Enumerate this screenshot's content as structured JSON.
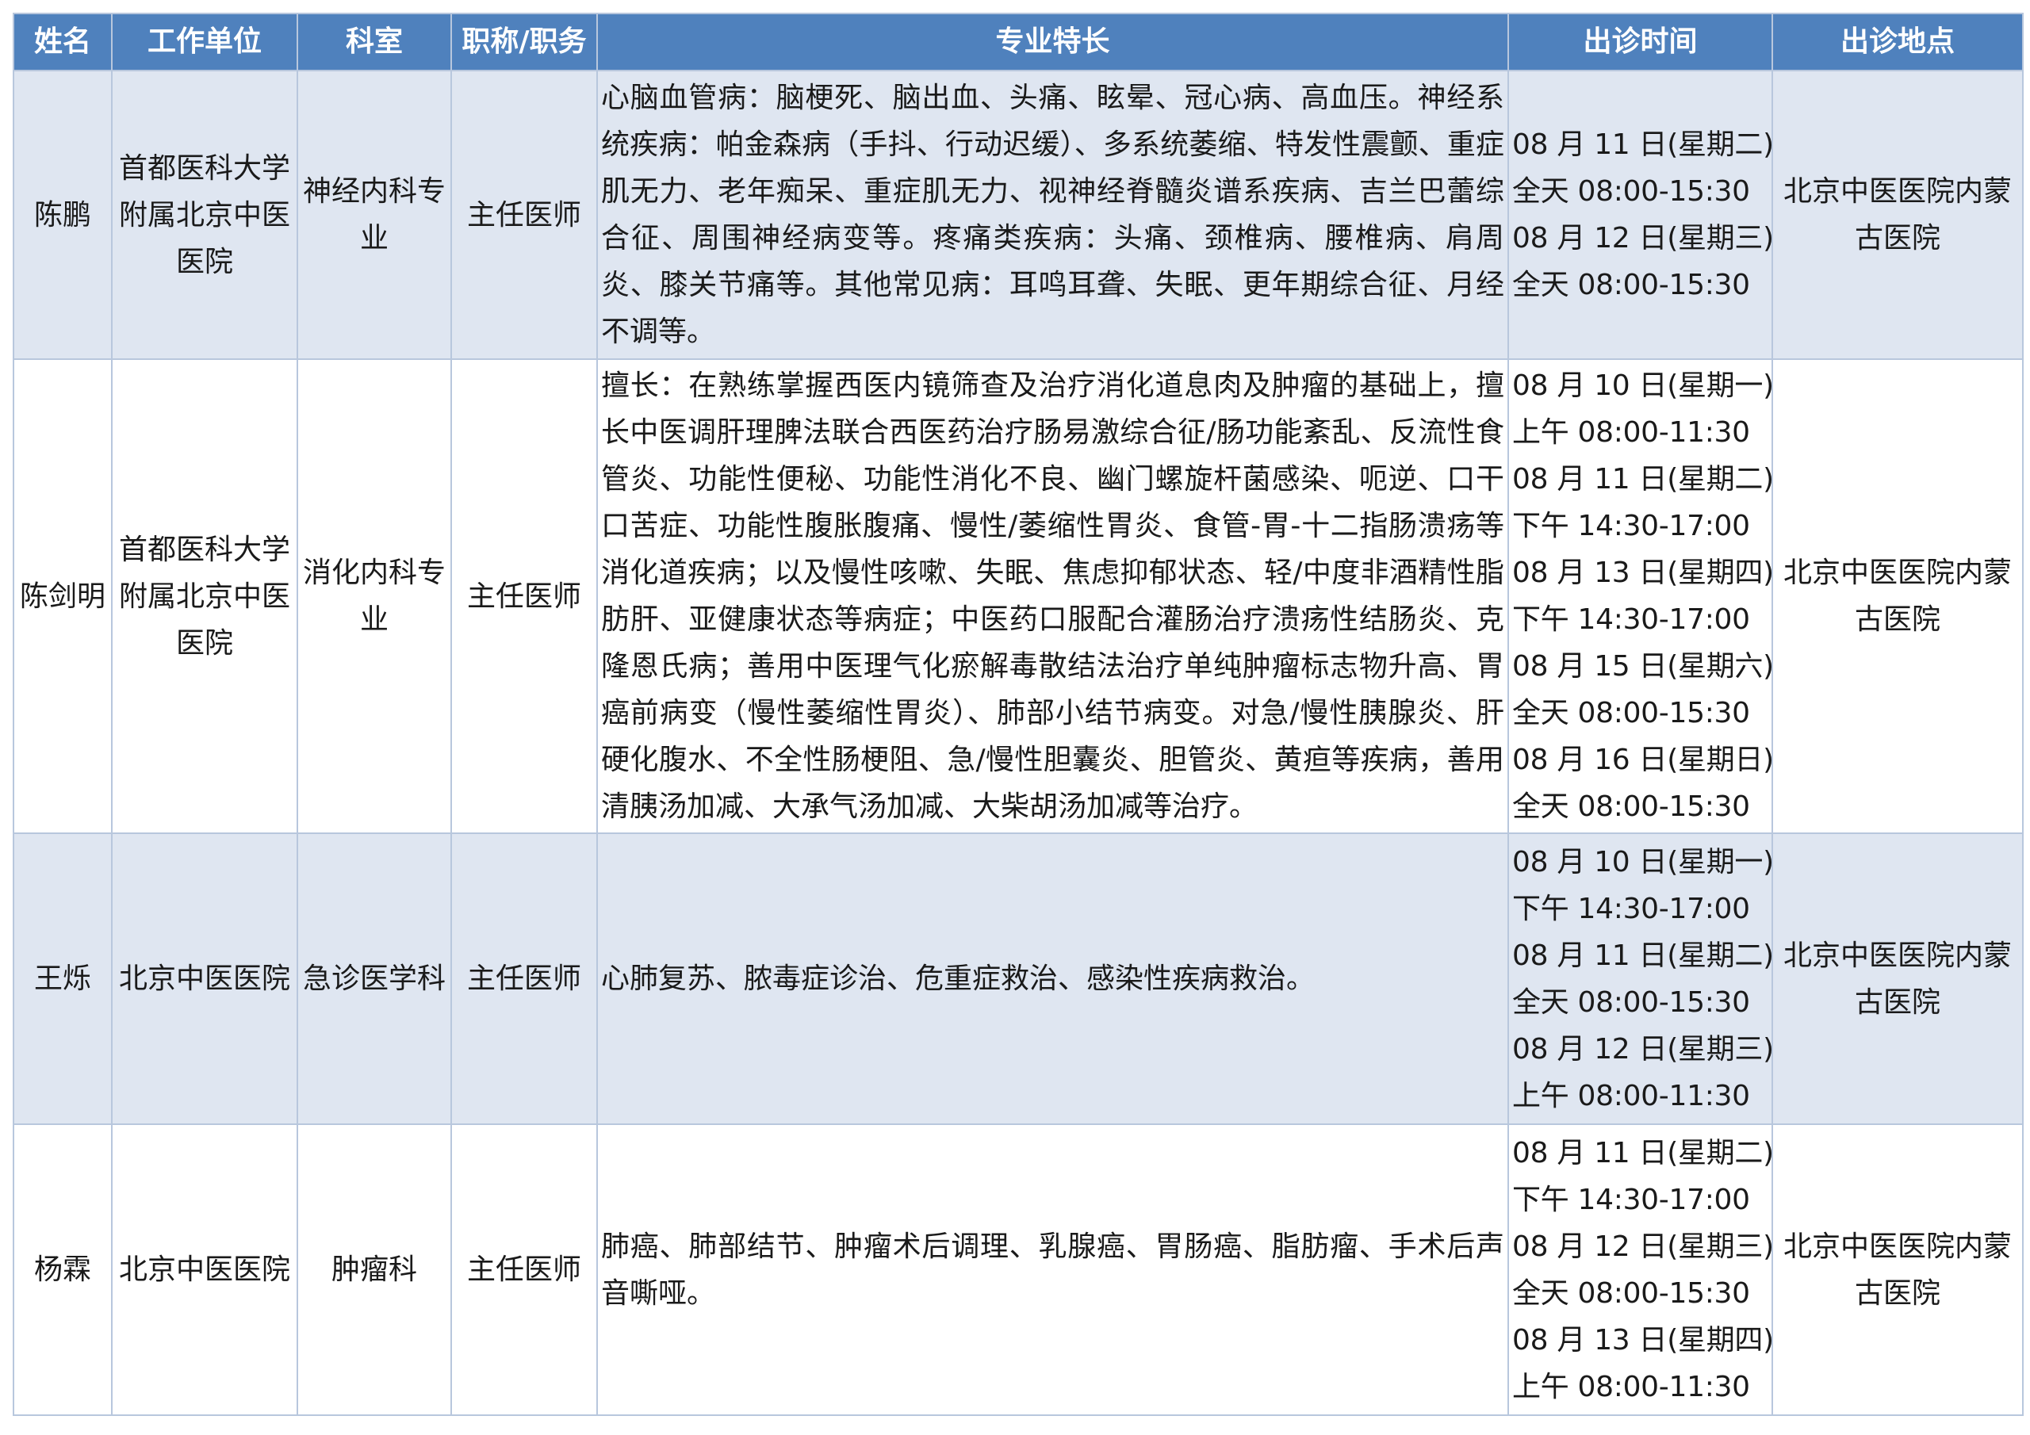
{
  "table": {
    "headers": [
      "姓名",
      "工作单位",
      "科室",
      "职称/职务",
      "专业特长",
      "出诊时间",
      "出诊地点"
    ],
    "rows": [
      {
        "name": "陈鹏",
        "unit": "首都医科大学附属北京中医医院",
        "dept": "神经内科专业",
        "title": "主任医师",
        "specialty": "心脑血管病：脑梗死、脑出血、头痛、眩晕、冠心病、高血压。神经系统疾病：帕金森病（手抖、行动迟缓）、多系统萎缩、特发性震颤、重症肌无力、老年痴呆、重症肌无力、视神经脊髓炎谱系疾病、吉兰巴蕾综合征、周围神经病变等。疼痛类疾病：头痛、颈椎病、腰椎病、肩周炎、膝关节痛等。其他常见病：耳鸣耳聋、失眠、更年期综合征、月经不调等。",
        "times": [
          "08 月 11 日(星期二)",
          "全天 08:00-15:30",
          "08 月 12 日(星期三)",
          "全天 08:00-15:30"
        ],
        "location": "北京中医医院内蒙古医院"
      },
      {
        "name": "陈剑明",
        "unit": "首都医科大学附属北京中医医院",
        "dept": "消化内科专业",
        "title": "主任医师",
        "specialty": "擅长：在熟练掌握西医内镜筛查及治疗消化道息肉及肿瘤的基础上，擅长中医调肝理脾法联合西医药治疗肠易激综合征/肠功能紊乱、反流性食管炎、功能性便秘、功能性消化不良、幽门螺旋杆菌感染、呃逆、口干口苦症、功能性腹胀腹痛、慢性/萎缩性胃炎、食管-胃-十二指肠溃疡等消化道疾病；以及慢性咳嗽、失眠、焦虑抑郁状态、轻/中度非酒精性脂肪肝、亚健康状态等病症；中医药口服配合灌肠治疗溃疡性结肠炎、克隆恩氏病；善用中医理气化瘀解毒散结法治疗单纯肿瘤标志物升高、胃癌前病变（慢性萎缩性胃炎）、肺部小结节病变。对急/慢性胰腺炎、肝硬化腹水、不全性肠梗阻、急/慢性胆囊炎、胆管炎、黄疸等疾病，善用清胰汤加减、大承气汤加减、大柴胡汤加减等治疗。",
        "times": [
          "08 月 10 日(星期一)",
          "上午 08:00-11:30",
          "08 月 11 日(星期二)",
          "下午 14:30-17:00",
          "08 月 13 日(星期四)",
          "下午 14:30-17:00",
          "08 月 15 日(星期六)",
          "全天 08:00-15:30",
          "08 月 16 日(星期日)",
          "全天 08:00-15:30"
        ],
        "location": "北京中医医院内蒙古医院"
      },
      {
        "name": "王烁",
        "unit": "北京中医医院",
        "dept": "急诊医学科",
        "title": "主任医师",
        "specialty": "心肺复苏、脓毒症诊治、危重症救治、感染性疾病救治。",
        "times": [
          "08 月 10 日(星期一)",
          "下午 14:30-17:00",
          "08 月 11 日(星期二)",
          "全天 08:00-15:30",
          "08 月 12 日(星期三)",
          "上午 08:00-11:30"
        ],
        "location": "北京中医医院内蒙古医院"
      },
      {
        "name": "杨霖",
        "unit": "北京中医医院",
        "dept": "肿瘤科",
        "title": "主任医师",
        "specialty": "肺癌、肺部结节、肿瘤术后调理、乳腺癌、胃肠癌、脂肪瘤、手术后声音嘶哑。",
        "times": [
          "08 月 11 日(星期二)",
          "下午 14:30-17:00",
          "08 月 12 日(星期三)",
          "全天 08:00-15:30",
          "08 月 13 日(星期四)",
          "上午 08:00-11:30"
        ],
        "location": "北京中医医院内蒙古医院"
      }
    ]
  }
}
